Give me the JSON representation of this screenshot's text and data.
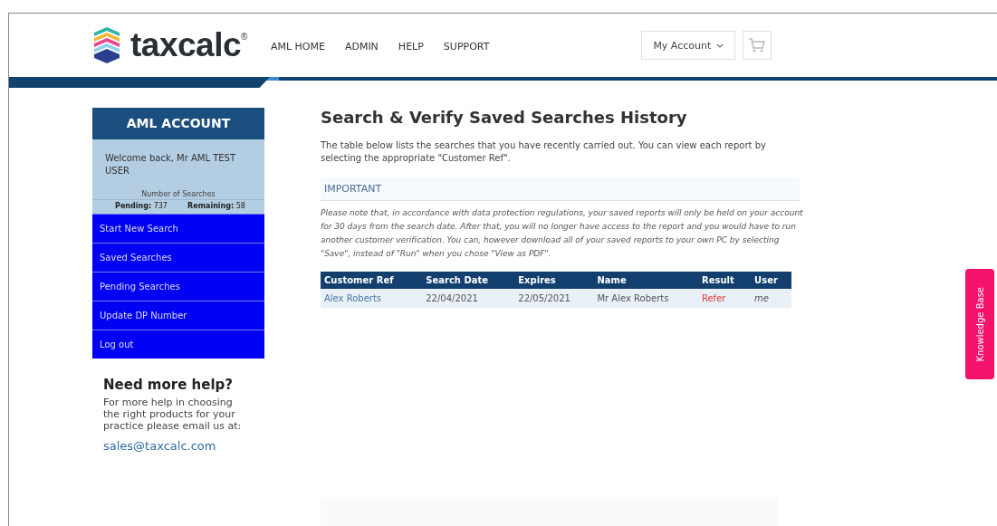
{
  "header": {
    "logo": "taxcalc$^{®}$",
    "nav": [
      "AML HOME",
      "ADMIN",
      "HELP",
      "SUPPORT"
    ],
    "account": "My Account"
  },
  "sidebar": {
    "title": "AML ACCOUNT",
    "welcome": "Welcome back, Mr AML TEST USER",
    "searches_label": "Number of Searches",
    "pending": "**Pending:** 737",
    "remaining": "**Remaining:** 58",
    "items": [
      "Start New Search",
      "Saved Searches",
      "Pending Searches",
      "Update DP Number",
      "Log out"
    ],
    "help_title": "Need more help?",
    "help_text": "For more help in choosing the right products for your practice please email us at:",
    "email": "sales@taxcalc.com"
  },
  "main": {
    "title": "Search & Verify Saved Searches History",
    "intro": "The table below lists the searches that you have recently carried out. You can view each report by selecting the appropriate \"Customer Ref\".",
    "important_title": "IMPORTANT",
    "important_text": "Please note that, in accordance with data protection regulations, your saved reports will only be held on your account for 30 days from the search date. After that, you will no longer have access to the report and you would have to run another customer verification. You can, however download all of your saved reports to your own PC by selecting \"Save\", instead of \"Run\" when you chose \"View as PDF\"."
  },
  "table": {
    "columns": [
      "Customer Ref",
      "Search Date",
      "Expires",
      "Name",
      "Result",
      "User"
    ],
    "rows": [
      [
        "Alex Roberts",
        "22/04/2021",
        "22/05/2021",
        "Mr Alex Roberts",
        "Refer",
        "me"
      ]
    ]
  },
  "side_tab": "Knowledge Base"
}
